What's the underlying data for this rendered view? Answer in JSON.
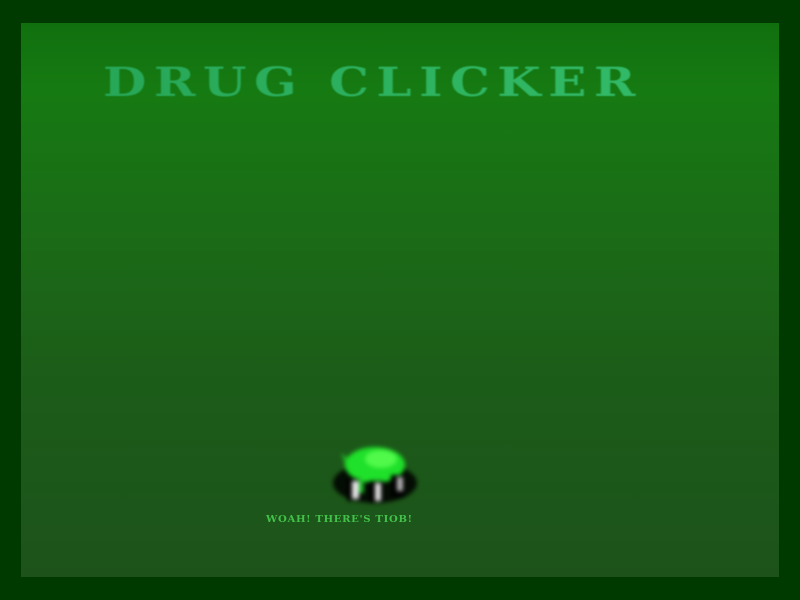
{
  "game": {
    "title": "DRUG CLICKER",
    "caption": "WOAH! THERE'S TIOB!"
  },
  "sprite": {
    "icon": "green-pill-clicker-icon",
    "colors": {
      "body": "#1fe02a",
      "shadow": "#000000",
      "highlight": "#ffffff"
    }
  },
  "colors": {
    "border": "#013a01",
    "background_top": "#10700e",
    "background_bottom": "#1d531a",
    "title": "#2fb560",
    "caption": "#43c14a"
  }
}
